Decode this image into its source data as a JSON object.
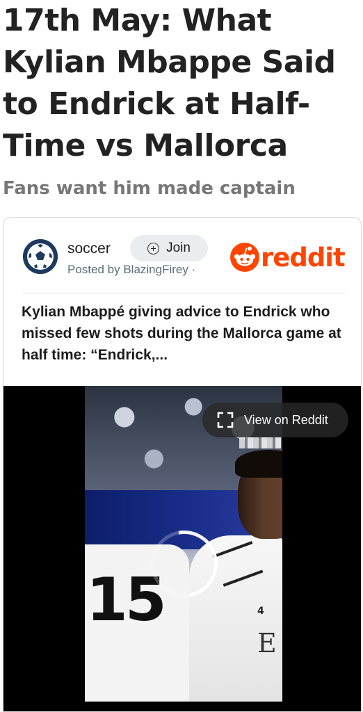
{
  "article": {
    "headline": "17th May: What Kylian Mbappe Said to Endrick at Half-Time vs Mallorca",
    "subheadline": "Fans want him made captain"
  },
  "embed": {
    "community": "soccer",
    "join_label": "Join",
    "posted_by": "Posted by BlazingFirey ·",
    "brand": "reddit",
    "post_title": "Kylian Mbappé giving advice to Endrick who missed few shots during the Mallorca game at half time: “Endrick,...",
    "video": {
      "view_button_label": "View on Reddit",
      "board_number": "15",
      "shirt_text": "E",
      "badge_text": "4"
    }
  },
  "colors": {
    "brand": "#ff4500",
    "avatar": "#1f3a5f",
    "subhead": "#777777"
  },
  "icons": [
    "soccer-ball-icon",
    "plus-circle-icon",
    "reddit-snoo-icon",
    "fullscreen-icon",
    "loading-spinner-icon"
  ]
}
